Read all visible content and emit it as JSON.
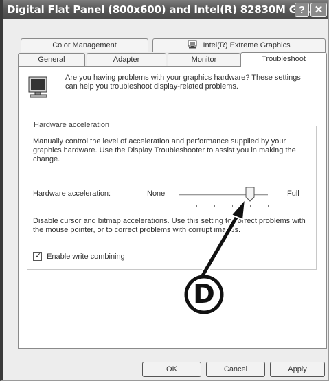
{
  "window": {
    "title": "Digital Flat Panel (800x600) and Intel(R) 82830M Gr...",
    "help_glyph": "?",
    "close_glyph": "✕"
  },
  "tabs": {
    "top_row": [
      {
        "label": "Color Management"
      },
      {
        "label": "Intel(R) Extreme Graphics",
        "icon": "intel-graphics-icon"
      }
    ],
    "bottom_row": [
      {
        "label": "General"
      },
      {
        "label": "Adapter"
      },
      {
        "label": "Monitor"
      },
      {
        "label": "Troubleshoot",
        "active": true
      }
    ]
  },
  "troubleshoot": {
    "intro": "Are you having problems with your graphics hardware? These settings can help you troubleshoot display-related problems.",
    "group_title": "Hardware acceleration",
    "description": "Manually control the level of acceleration and performance supplied by your graphics hardware. Use the Display Troubleshooter to assist you in making the change.",
    "slider_label": "Hardware acceleration:",
    "slider_min_label": "None",
    "slider_max_label": "Full",
    "slider_level_fraction": 0.8,
    "disable_text": "Disable cursor and bitmap accelerations. Use this setting to correct problems with the mouse pointer, or to correct problems with corrupt images.",
    "checkbox_label": "Enable write combining",
    "checkbox_checked": true,
    "checkbox_mark": "✓"
  },
  "buttons": {
    "ok": "OK",
    "cancel": "Cancel",
    "apply": "Apply"
  },
  "callout": {
    "letter": "D"
  }
}
